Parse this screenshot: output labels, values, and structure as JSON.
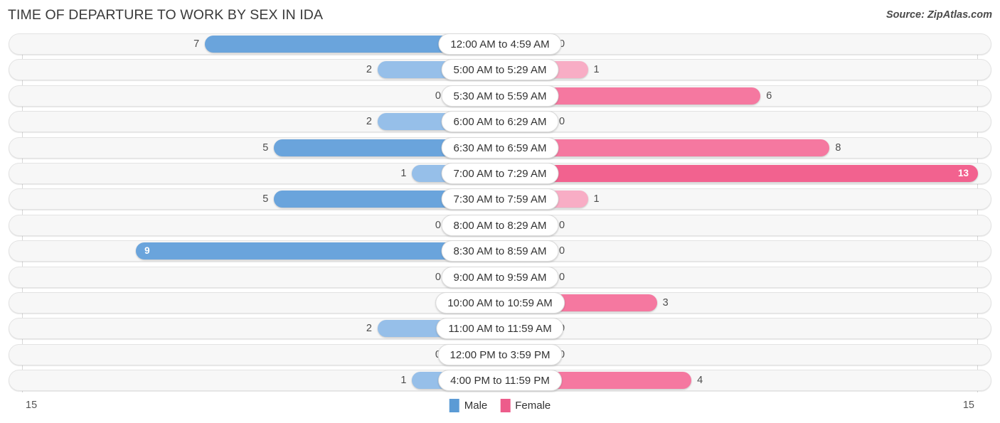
{
  "header": {
    "title": "TIME OF DEPARTURE TO WORK BY SEX IN IDA",
    "source": "Source: ZipAtlas.com"
  },
  "axis": {
    "left_max": "15",
    "right_max": "15"
  },
  "legend": {
    "items": [
      {
        "label": "Male",
        "color": "#5B9BD5"
      },
      {
        "label": "Female",
        "color": "#ED5C8B"
      }
    ]
  },
  "colors": {
    "male_strong": "#6AA4DC",
    "male_light": "#96BFE9",
    "female_strong": "#F2628F",
    "female_mid": "#F578A0",
    "female_light": "#F8ADC5",
    "track": "#F7F7F7",
    "gridline": "#D8D8D8"
  },
  "chart_data": {
    "type": "bar",
    "orientation": "horizontal-diverging",
    "title": "TIME OF DEPARTURE TO WORK BY SEX IN IDA",
    "xlabel": "",
    "ylabel": "",
    "xlim": [
      15,
      15
    ],
    "grid": true,
    "legend_position": "bottom-center",
    "categories": [
      "12:00 AM to 4:59 AM",
      "5:00 AM to 5:29 AM",
      "5:30 AM to 5:59 AM",
      "6:00 AM to 6:29 AM",
      "6:30 AM to 6:59 AM",
      "7:00 AM to 7:29 AM",
      "7:30 AM to 7:59 AM",
      "8:00 AM to 8:29 AM",
      "8:30 AM to 8:59 AM",
      "9:00 AM to 9:59 AM",
      "10:00 AM to 10:59 AM",
      "11:00 AM to 11:59 AM",
      "12:00 PM to 3:59 PM",
      "4:00 PM to 11:59 PM"
    ],
    "series": [
      {
        "name": "Male",
        "values": [
          7,
          2,
          0,
          2,
          5,
          1,
          5,
          0,
          9,
          0,
          0,
          2,
          0,
          1
        ]
      },
      {
        "name": "Female",
        "values": [
          0,
          1,
          6,
          0,
          8,
          13,
          1,
          0,
          0,
          0,
          3,
          0,
          0,
          4
        ]
      }
    ]
  },
  "rows": [
    {
      "category": "12:00 AM to 4:59 AM",
      "male": "7",
      "female": "0"
    },
    {
      "category": "5:00 AM to 5:29 AM",
      "male": "2",
      "female": "1"
    },
    {
      "category": "5:30 AM to 5:59 AM",
      "male": "0",
      "female": "6"
    },
    {
      "category": "6:00 AM to 6:29 AM",
      "male": "2",
      "female": "0"
    },
    {
      "category": "6:30 AM to 6:59 AM",
      "male": "5",
      "female": "8"
    },
    {
      "category": "7:00 AM to 7:29 AM",
      "male": "1",
      "female": "13"
    },
    {
      "category": "7:30 AM to 7:59 AM",
      "male": "5",
      "female": "1"
    },
    {
      "category": "8:00 AM to 8:29 AM",
      "male": "0",
      "female": "0"
    },
    {
      "category": "8:30 AM to 8:59 AM",
      "male": "9",
      "female": "0"
    },
    {
      "category": "9:00 AM to 9:59 AM",
      "male": "0",
      "female": "0"
    },
    {
      "category": "10:00 AM to 10:59 AM",
      "male": "0",
      "female": "3"
    },
    {
      "category": "11:00 AM to 11:59 AM",
      "male": "2",
      "female": "0"
    },
    {
      "category": "12:00 PM to 3:59 PM",
      "male": "0",
      "female": "0"
    },
    {
      "category": "4:00 PM to 11:59 PM",
      "male": "1",
      "female": "4"
    }
  ]
}
